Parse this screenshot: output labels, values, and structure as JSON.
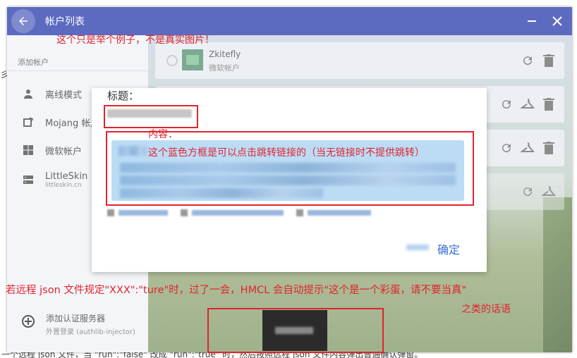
{
  "window": {
    "title": "帐户列表"
  },
  "sidebar": {
    "header": "添加帐户",
    "items": [
      {
        "label": "离线模式",
        "icon": "person-icon"
      },
      {
        "label": "Mojang 帐户",
        "icon": "mojang-icon"
      },
      {
        "label": "微软帐户",
        "icon": "windows-icon"
      },
      {
        "label": "LittleSkin",
        "sub": "littleskin.cn",
        "icon": "server-icon"
      }
    ],
    "add_server": {
      "label": "添加认证服务器",
      "sub": "外置登录 (authlib-injector)"
    }
  },
  "accounts": [
    {
      "name": "Zkitefly",
      "type": "微软帐户"
    }
  ],
  "dialog": {
    "title_label": "标题：",
    "ok_label": "确定"
  },
  "annotations": {
    "top_note": "这个只是举个例子，不是真实图片！",
    "content_label": "内容：",
    "content_note": "这个蓝色方框是可以点击跳转链接的（当无链接时不提供跳转）",
    "bottom_note_1": "若远程 json 文件规定\"XXX\":\"ture\"时，过了一会，HMCL 会自动提示\"这个是一个彩蛋，请不要当真\"",
    "bottom_note_2": "之类的话语",
    "colors": {
      "annotation_red": "#e0242e",
      "title_bar": "#5c6bc0",
      "link_blue": "#3b6fd1"
    }
  },
  "background": {
    "left_letters": "彡",
    "bottom_text": "一个远程 json 文件，当 \"run\":\"false\" 改成 \"run\":\"true\" 时，然后按照远程 json 文件内容弹出普通确认弹窗。"
  }
}
